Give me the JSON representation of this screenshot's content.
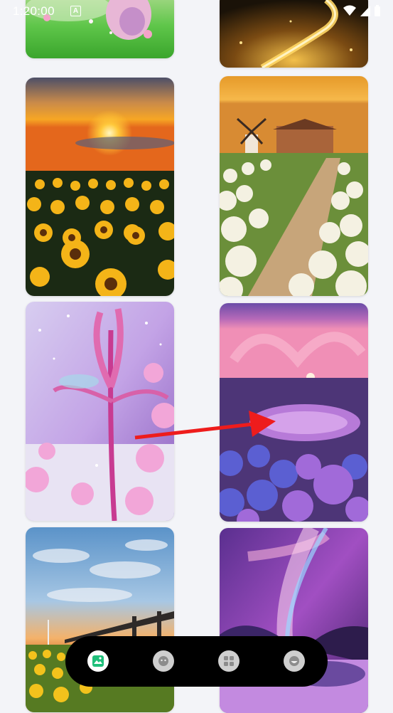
{
  "status_bar": {
    "time": "1:20:00",
    "notification_letter": "A",
    "icons": [
      "wifi-icon",
      "cellular-signal-icon",
      "battery-icon"
    ]
  },
  "gallery": {
    "images": [
      {
        "name": "pink-creature-on-grass-image"
      },
      {
        "name": "golden-glowing-path-image"
      },
      {
        "name": "sunflower-field-sunset-image"
      },
      {
        "name": "windmill-hydrangea-path-image"
      },
      {
        "name": "pink-lily-flower-image"
      },
      {
        "name": "purple-lake-hydrangea-image"
      },
      {
        "name": "sunflower-pier-sky-image"
      },
      {
        "name": "purple-galaxy-vortex-image"
      }
    ]
  },
  "annotation": {
    "arrow_color": "#ee1c1c"
  },
  "nav_bar": {
    "items": [
      {
        "icon": "gallery-icon",
        "active": true
      },
      {
        "icon": "face-icon",
        "active": false
      },
      {
        "icon": "grid-apps-icon",
        "active": false
      },
      {
        "icon": "profile-icon",
        "active": false
      }
    ]
  }
}
